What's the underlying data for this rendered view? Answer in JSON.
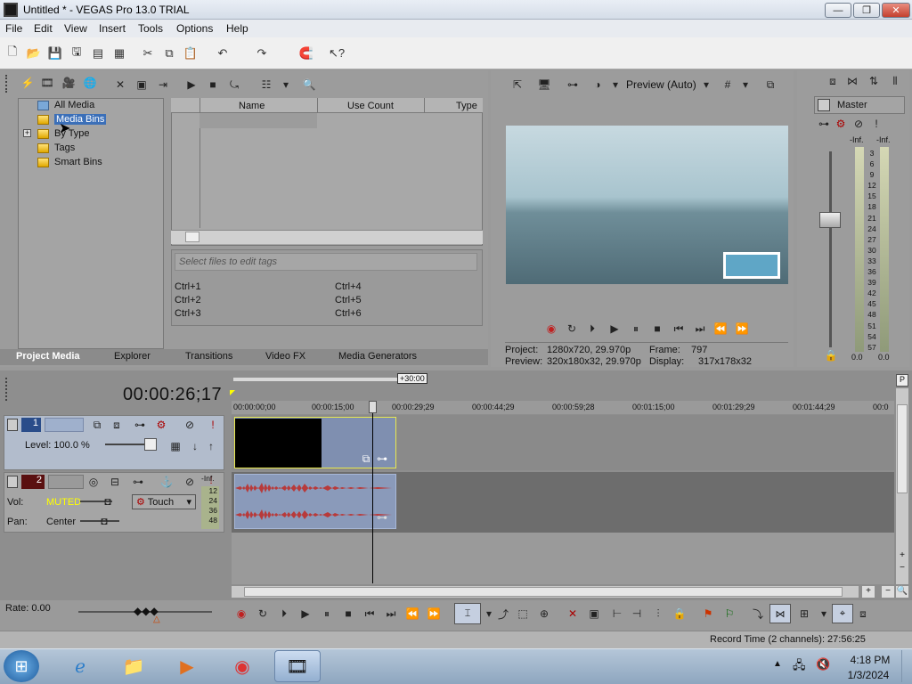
{
  "window": {
    "title": "Untitled * - VEGAS Pro 13.0 TRIAL"
  },
  "menu": [
    "File",
    "Edit",
    "View",
    "Insert",
    "Tools",
    "Options",
    "Help"
  ],
  "project_media": {
    "tree": [
      {
        "label": "All Media"
      },
      {
        "label": "Media Bins"
      },
      {
        "label": "By Type"
      },
      {
        "label": "Tags"
      },
      {
        "label": "Smart Bins"
      }
    ],
    "columns": [
      "Name",
      "Use Count",
      "Type"
    ],
    "tag_placeholder": "Select files to edit tags",
    "shortcuts": [
      "Ctrl+1",
      "Ctrl+4",
      "Ctrl+2",
      "Ctrl+5",
      "Ctrl+3",
      "Ctrl+6"
    ]
  },
  "bottom_tabs": [
    "Project Media",
    "Explorer",
    "Transitions",
    "Video FX",
    "Media Generators"
  ],
  "preview": {
    "mode": "Preview (Auto)",
    "project_label": "Project:",
    "project": "1280x720, 29.970p",
    "frame_label": "Frame:",
    "frame": "797",
    "preview_label": "Preview:",
    "preview": "320x180x32, 29.970p",
    "display_label": "Display:",
    "display": "317x178x32"
  },
  "master": {
    "label": "Master",
    "inf_left": "-Inf.",
    "inf_right": "-Inf.",
    "scale": [
      "3",
      "6",
      "9",
      "12",
      "15",
      "18",
      "21",
      "24",
      "27",
      "30",
      "33",
      "36",
      "39",
      "42",
      "45",
      "48",
      "51",
      "54",
      "57"
    ],
    "bottom_left": "0.0",
    "bottom_right": "0.0"
  },
  "timeline": {
    "timecode": "00:00:26;17",
    "region_length": "+30:00",
    "ruler": [
      "00:00:00;00",
      "00:00:15;00",
      "00:00:29;29",
      "00:00:44;29",
      "00:00:59;28",
      "00:01:15;00",
      "00:01:29;29",
      "00:01:44;29",
      "00:0"
    ],
    "track1": {
      "number": "1",
      "level": "Level: 100.0 %"
    },
    "track2": {
      "number": "2",
      "vol_label": "Vol:",
      "vol": "MUTED",
      "mode": "Touch",
      "pan_label": "Pan:",
      "pan": "Center",
      "inf": "-Inf.",
      "scale": [
        "12",
        "24",
        "36",
        "48"
      ]
    },
    "rate": "Rate: 0.00",
    "record_time": "Record Time (2 channels): 27:56:25"
  },
  "taskbar": {
    "time": "4:18 PM",
    "date": "1/3/2024"
  }
}
